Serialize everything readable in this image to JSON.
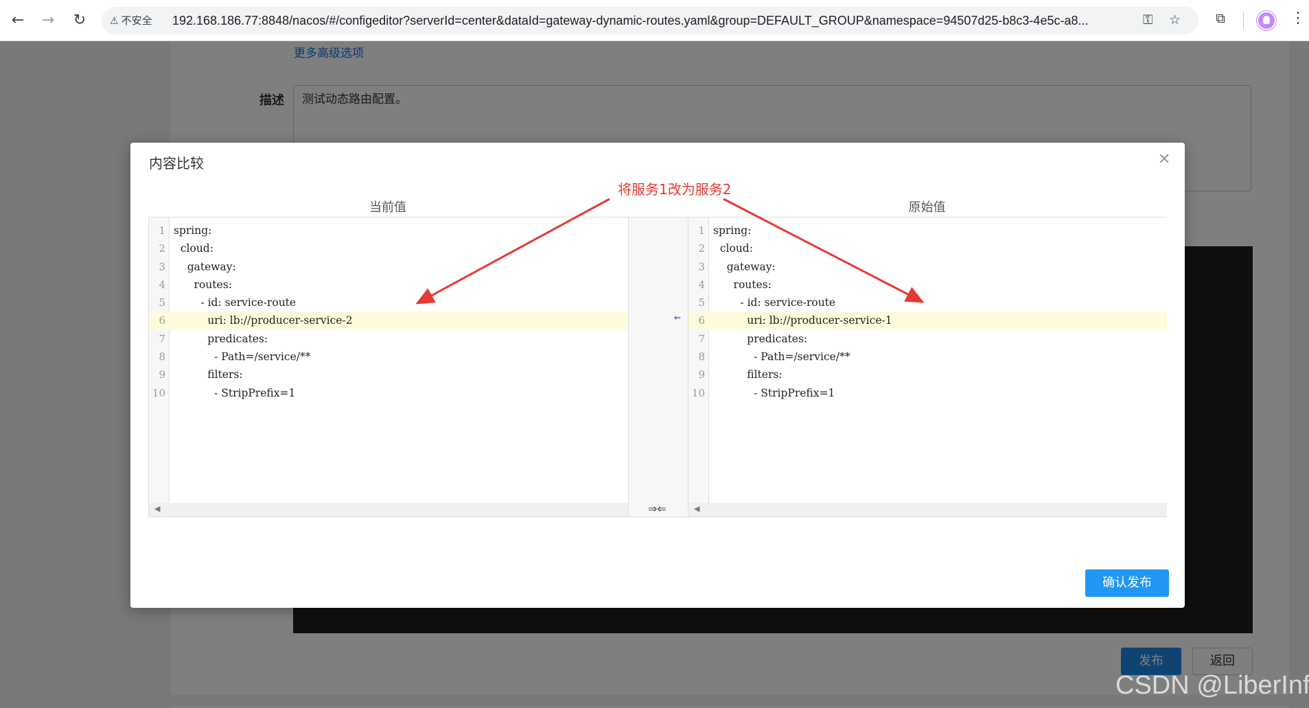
{
  "browser": {
    "security_label": "不安全",
    "url": "192.168.186.77:8848/nacos/#/configeditor?serverId=center&dataId=gateway-dynamic-routes.yaml&group=DEFAULT_GROUP&namespace=94507d25-b8c3-4e5c-a8...",
    "icons": [
      "back-icon",
      "forward-icon",
      "reload-icon",
      "warning-icon",
      "key-icon",
      "star-icon",
      "extensions-icon",
      "profile-avatar",
      "more-menu-icon"
    ]
  },
  "page": {
    "advanced_options_link": "更多高级选项",
    "description_label": "描述",
    "description_value": "测试动态路由配置。",
    "publish_button": "发布",
    "back_button": "返回"
  },
  "modal": {
    "title": "内容比较",
    "current_title": "当前值",
    "original_title": "原始值",
    "confirm_button": "确认发布",
    "changed_line": 6,
    "current_lines": [
      "spring:",
      "  cloud:",
      "    gateway:",
      "      routes:",
      "        - id: service-route",
      "          uri: lb://producer-service-2",
      "          predicates:",
      "            - Path=/service/**",
      "          filters:",
      "            - StripPrefix=1"
    ],
    "original_lines": [
      "spring:",
      "  cloud:",
      "    gateway:",
      "      routes:",
      "        - id: service-route",
      "          uri: lb://producer-service-1",
      "          predicates:",
      "            - Path=/service/**",
      "          filters:",
      "            - StripPrefix=1"
    ],
    "gap_arrow": "⇜",
    "gap_bottom": "⇒⇐"
  },
  "annotation": {
    "text": "将服务1改为服务2",
    "color": "#e53935"
  },
  "watermark": "CSDN @LiberInfo",
  "colors": {
    "accent": "#2196f3",
    "changed_line_bg": "#fefbdd",
    "annotation": "#e53935"
  }
}
